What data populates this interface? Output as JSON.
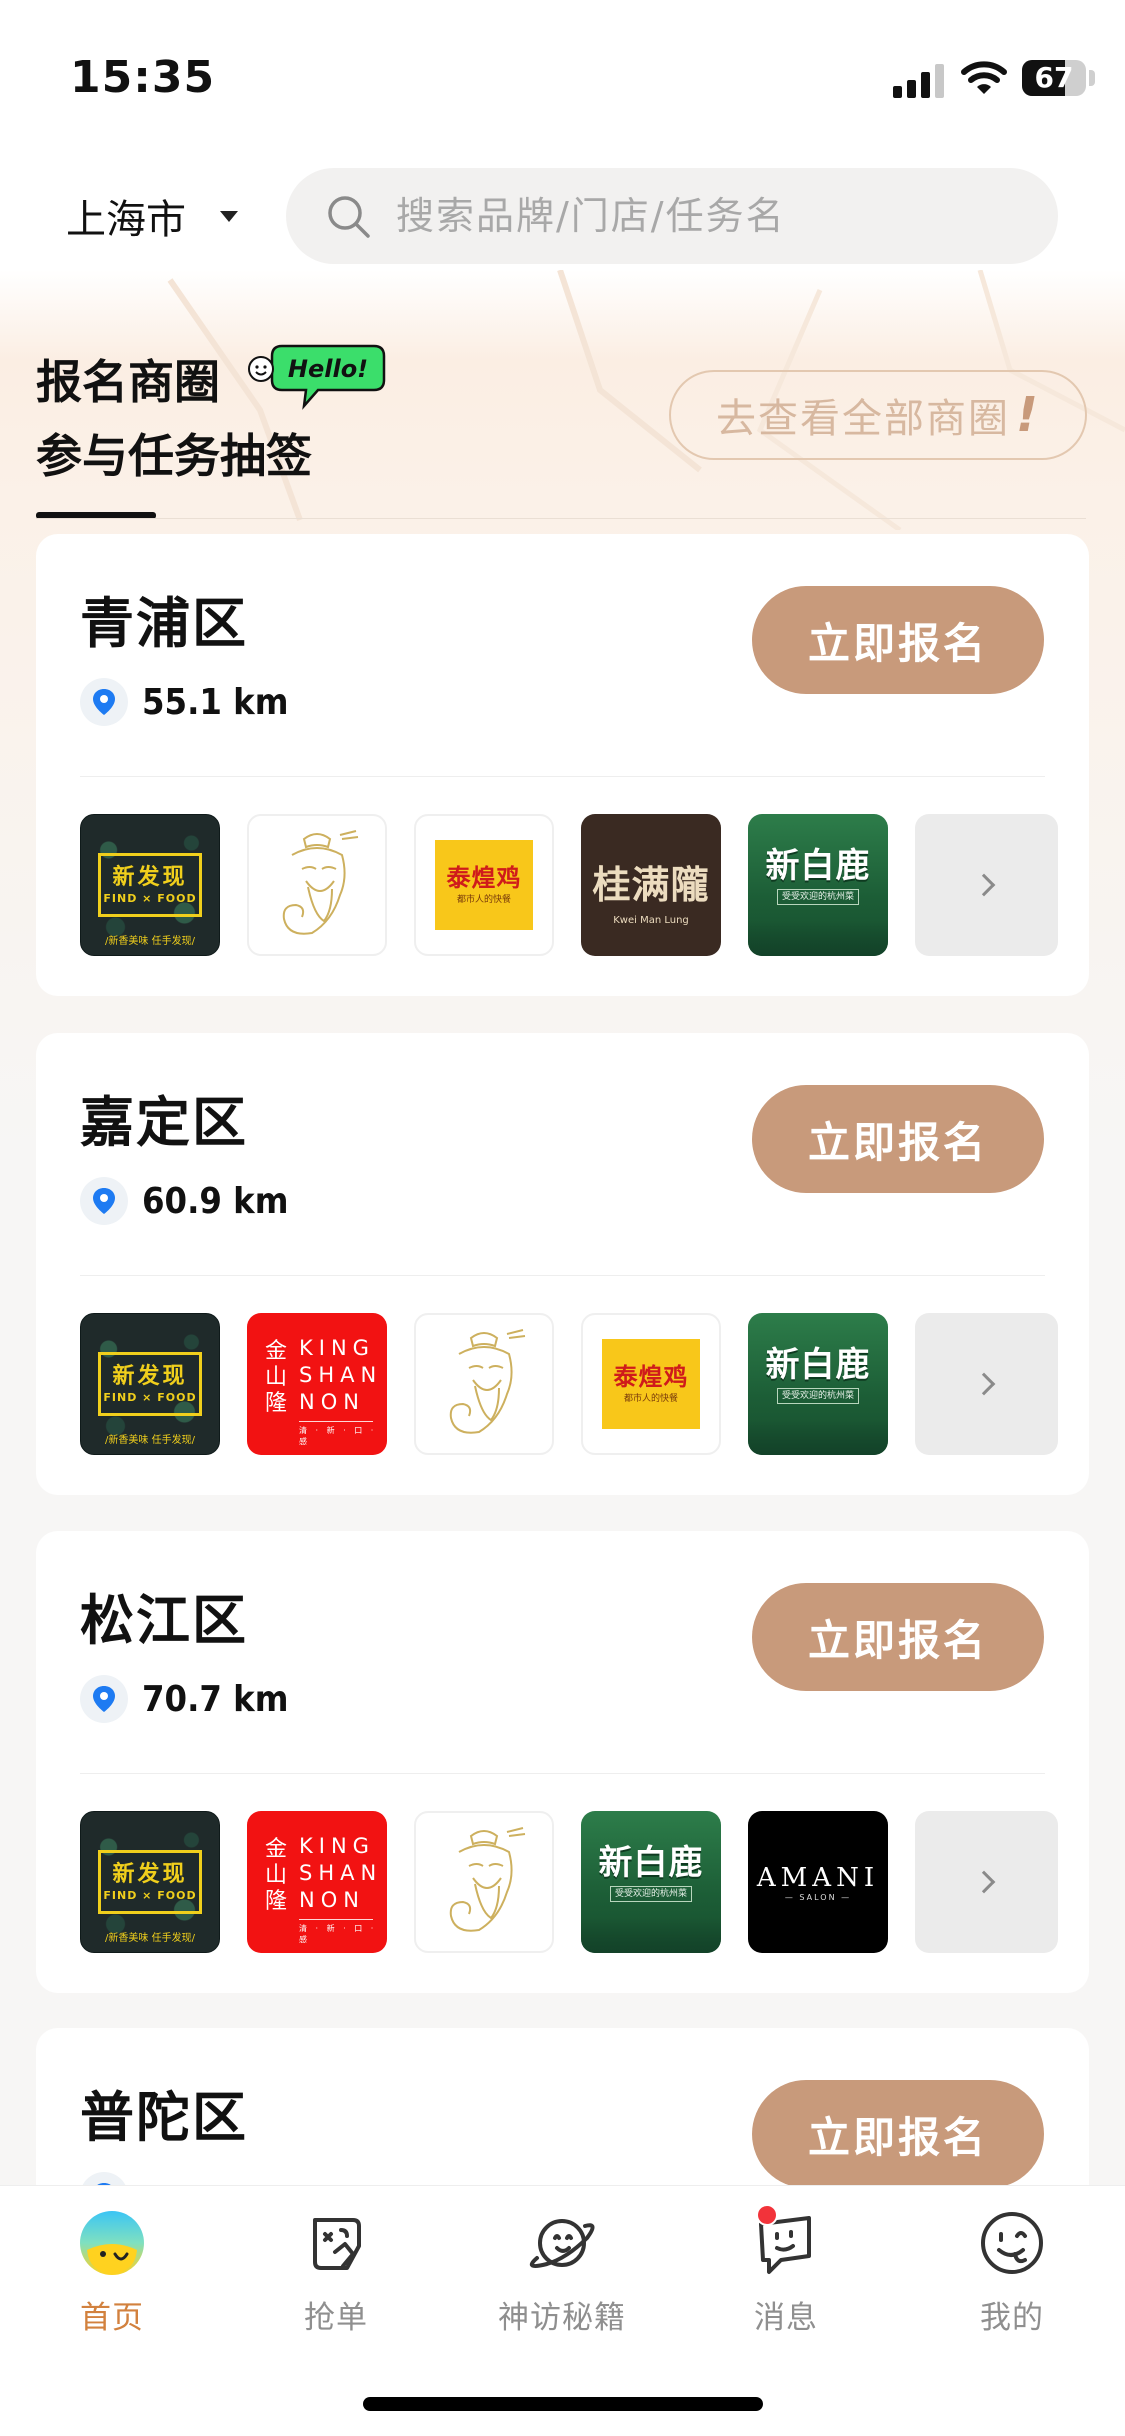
{
  "status": {
    "time": "15:35",
    "battery_percent": 67,
    "battery_label": "67"
  },
  "header": {
    "city": "上海市",
    "search_placeholder": "搜索品牌/门店/任务名"
  },
  "promo": {
    "title_line1": "报名商圈",
    "title_line2": "参与任务抽签",
    "hello_badge": "Hello!",
    "see_all_label": "去查看全部商圈",
    "see_all_mark": "!"
  },
  "cards": [
    {
      "district": "青浦区",
      "distance": "55.1 km",
      "button": "立即报名"
    },
    {
      "district": "嘉定区",
      "distance": "60.9 km",
      "button": "立即报名"
    },
    {
      "district": "松江区",
      "distance": "70.7 km",
      "button": "立即报名"
    },
    {
      "district": "普陀区",
      "distance": "",
      "button": "立即报名"
    }
  ],
  "logos": {
    "xinfaxian": {
      "title": "新发现",
      "sub": "FIND × FOOD",
      "tag": "/新香美味 任手发现/"
    },
    "taiguoji": {
      "title": "泰煌鸡",
      "sub": "都市人的快餐"
    },
    "guimanlong": {
      "title": "桂满隴",
      "sub": "Kwei Man Lung"
    },
    "xinbailu": {
      "title": "新白鹿",
      "sub": "受受欢迎的杭州菜"
    },
    "kingshannon": {
      "title": "金山隆",
      "en": "KING SHAN NON",
      "tiny": "清 · 新 · 口 · 感"
    },
    "amani": {
      "title": "AMANI",
      "sub": "— SALON —"
    }
  },
  "tabbar": [
    {
      "label": "首页",
      "icon": "home-face-icon",
      "active": true
    },
    {
      "label": "抢单",
      "icon": "grab-order-icon",
      "active": false
    },
    {
      "label": "神访秘籍",
      "icon": "planet-icon",
      "active": false
    },
    {
      "label": "消息",
      "icon": "message-icon",
      "active": false,
      "badge": true
    },
    {
      "label": "我的",
      "icon": "profile-face-icon",
      "active": false
    }
  ],
  "colors": {
    "accent": "#c89a7b",
    "active_tab": "#d2813e",
    "pin": "#1e7bf2"
  }
}
